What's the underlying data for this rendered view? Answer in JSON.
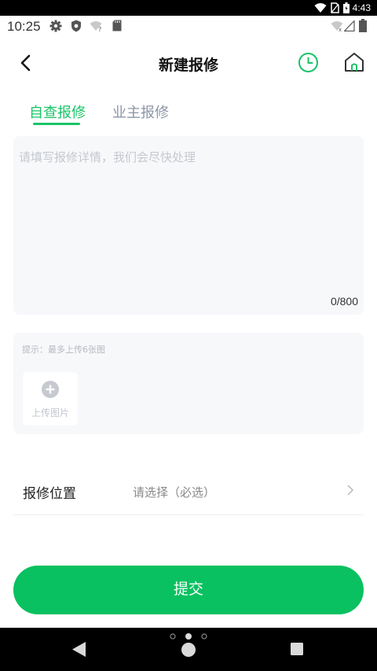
{
  "system_status": {
    "time": "4:43"
  },
  "app_status": {
    "time": "10:25"
  },
  "header": {
    "title": "新建报修"
  },
  "tabs": [
    {
      "label": "自查报修",
      "active": true
    },
    {
      "label": "业主报修",
      "active": false
    }
  ],
  "description": {
    "placeholder": "请填写报修详情，我们会尽快处理",
    "counter": "0/800"
  },
  "upload": {
    "tip": "提示：最多上传6张图",
    "button_label": "上传图片"
  },
  "location": {
    "label": "报修位置",
    "value": "请选择（必选）"
  },
  "submit": {
    "label": "提交"
  },
  "colors": {
    "accent": "#19c467",
    "button": "#09c160",
    "panel": "#f7f8fa"
  },
  "icons": [
    "back-arrow-icon",
    "clock-icon",
    "home-icon",
    "plus-circle-icon",
    "chevron-right-icon",
    "wifi-icon",
    "battery-icon",
    "gear-icon",
    "shield-icon",
    "sd-card-icon",
    "signal-icon"
  ]
}
